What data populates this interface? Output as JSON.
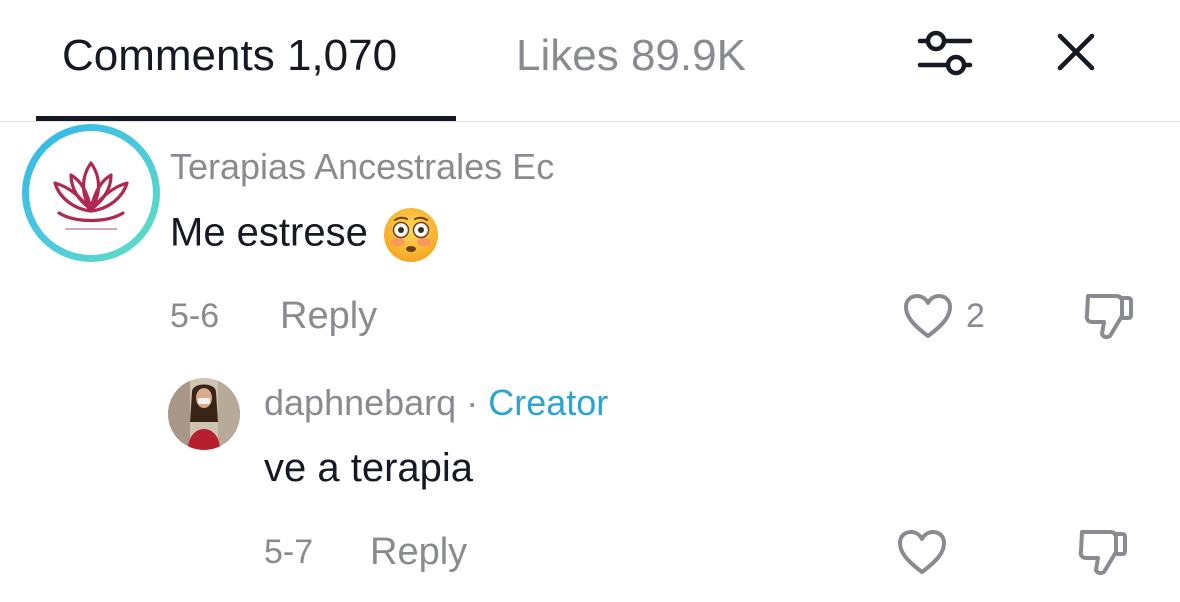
{
  "header": {
    "comments_tab": "Comments 1,070",
    "likes_tab": "Likes 89.9K"
  },
  "comments": [
    {
      "username": "Terapias Ancestrales Ec",
      "text": "Me estrese",
      "emoji": "flushed-face-emoji",
      "date": "5-6",
      "reply_label": "Reply",
      "like_count": "2"
    }
  ],
  "replies": [
    {
      "username": "daphnebarq",
      "separator": "·",
      "badge": "Creator",
      "text": "ve a terapia",
      "date": "5-7",
      "reply_label": "Reply"
    }
  ],
  "colors": {
    "primary_text": "#161823",
    "secondary_text": "#8a8b91",
    "creator_badge": "#2aa4d4",
    "avatar_ring_start": "#2bb7ea",
    "avatar_ring_end": "#5fe0c0",
    "lotus": "#b0284f"
  }
}
